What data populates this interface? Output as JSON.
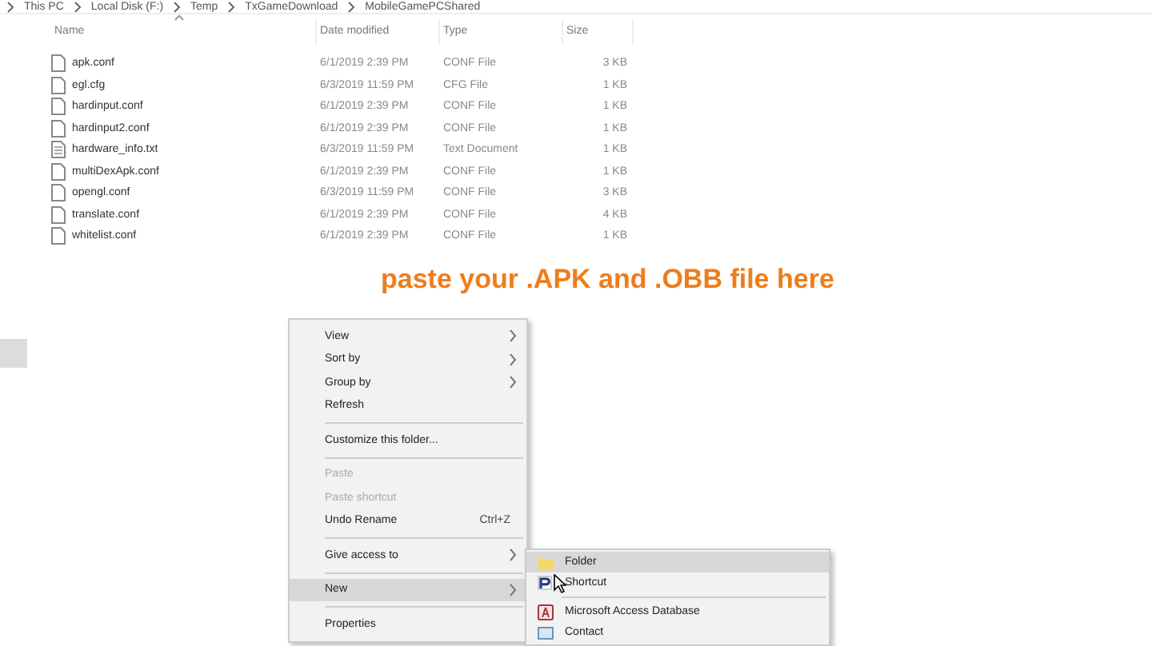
{
  "breadcrumb": [
    "This PC",
    "Local Disk (F:)",
    "Temp",
    "TxGameDownload",
    "MobileGamePCShared"
  ],
  "columns": [
    "Name",
    "Date modified",
    "Type",
    "Size"
  ],
  "files": [
    {
      "name": "apk.conf",
      "date": "6/1/2019 2:39 PM",
      "type": "CONF File",
      "size": "3 KB",
      "kind": "file"
    },
    {
      "name": "egl.cfg",
      "date": "6/3/2019 11:59 PM",
      "type": "CFG File",
      "size": "1 KB",
      "kind": "file"
    },
    {
      "name": "hardinput.conf",
      "date": "6/1/2019 2:39 PM",
      "type": "CONF File",
      "size": "1 KB",
      "kind": "file"
    },
    {
      "name": "hardinput2.conf",
      "date": "6/1/2019 2:39 PM",
      "type": "CONF File",
      "size": "1 KB",
      "kind": "file"
    },
    {
      "name": "hardware_info.txt",
      "date": "6/3/2019 11:59 PM",
      "type": "Text Document",
      "size": "1 KB",
      "kind": "text"
    },
    {
      "name": "multiDexApk.conf",
      "date": "6/1/2019 2:39 PM",
      "type": "CONF File",
      "size": "1 KB",
      "kind": "file"
    },
    {
      "name": "opengl.conf",
      "date": "6/3/2019 11:59 PM",
      "type": "CONF File",
      "size": "3 KB",
      "kind": "file"
    },
    {
      "name": "translate.conf",
      "date": "6/1/2019 2:39 PM",
      "type": "CONF File",
      "size": "4 KB",
      "kind": "file"
    },
    {
      "name": "whitelist.conf",
      "date": "6/1/2019 2:39 PM",
      "type": "CONF File",
      "size": "1 KB",
      "kind": "file"
    }
  ],
  "annotation": "paste your .APK and .OBB file here",
  "context_menu": [
    {
      "kind": "item",
      "label": "View",
      "submenu": true,
      "disabled": false,
      "selected": false
    },
    {
      "kind": "item",
      "label": "Sort by",
      "submenu": true,
      "disabled": false,
      "selected": false
    },
    {
      "kind": "item",
      "label": "Group by",
      "submenu": true,
      "disabled": false,
      "selected": false
    },
    {
      "kind": "item",
      "label": "Refresh",
      "submenu": false,
      "disabled": false,
      "selected": false
    },
    {
      "kind": "separator"
    },
    {
      "kind": "item",
      "label": "Customize this folder...",
      "submenu": false,
      "disabled": false,
      "selected": false
    },
    {
      "kind": "separator"
    },
    {
      "kind": "item",
      "label": "Paste",
      "submenu": false,
      "disabled": true,
      "selected": false
    },
    {
      "kind": "item",
      "label": "Paste shortcut",
      "submenu": false,
      "disabled": true,
      "selected": false
    },
    {
      "kind": "item",
      "label": "Undo Rename",
      "shortcut": "Ctrl+Z",
      "submenu": false,
      "disabled": false,
      "selected": false
    },
    {
      "kind": "separator"
    },
    {
      "kind": "item",
      "label": "Give access to",
      "submenu": true,
      "disabled": false,
      "selected": false
    },
    {
      "kind": "separator"
    },
    {
      "kind": "item",
      "label": "New",
      "submenu": true,
      "disabled": false,
      "selected": true
    },
    {
      "kind": "separator"
    },
    {
      "kind": "item",
      "label": "Properties",
      "submenu": false,
      "disabled": false,
      "selected": false
    }
  ],
  "new_submenu": [
    {
      "kind": "folder",
      "label": "Folder",
      "selected": true
    },
    {
      "kind": "shortcut",
      "label": "Shortcut",
      "selected": false
    },
    {
      "kind": "separator"
    },
    {
      "kind": "access",
      "label": "Microsoft Access Database",
      "selected": false
    },
    {
      "kind": "contact",
      "label": "Contact",
      "selected": false
    }
  ]
}
